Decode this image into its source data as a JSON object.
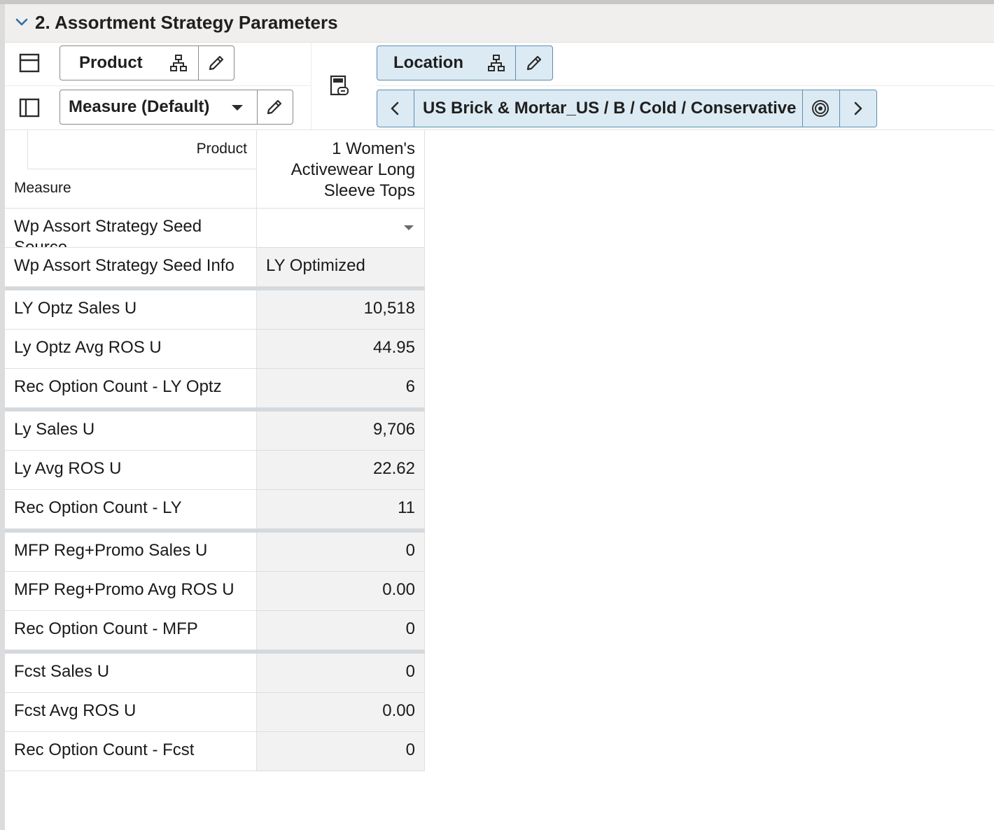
{
  "section": {
    "title": "2. Assortment Strategy Parameters"
  },
  "toolbar": {
    "row_dimension": "Product",
    "column_dimension": "Measure (Default)",
    "page_dimension": "Location",
    "location_path": "US Brick & Mortar_US / B / Cold / Conservative"
  },
  "grid": {
    "corner_top_label": "Product",
    "corner_bottom_label": "Measure",
    "column_header": "1 Women's Activewear Long Sleeve Tops",
    "rows": [
      {
        "label": "Wp Assort Strategy Seed Source",
        "value": ""
      },
      {
        "label": "Wp Assort Strategy Seed Info",
        "value": "LY Optimized"
      },
      {
        "label": "LY Optz Sales U",
        "value": "10,518"
      },
      {
        "label": "Ly Optz Avg ROS U",
        "value": "44.95"
      },
      {
        "label": "Rec Option Count - LY Optz",
        "value": "6"
      },
      {
        "label": "Ly Sales U",
        "value": "9,706"
      },
      {
        "label": "Ly Avg ROS U",
        "value": "22.62"
      },
      {
        "label": "Rec Option Count - LY",
        "value": "11"
      },
      {
        "label": "MFP Reg+Promo Sales U",
        "value": "0"
      },
      {
        "label": "MFP Reg+Promo Avg ROS U",
        "value": "0.00"
      },
      {
        "label": "Rec Option Count - MFP",
        "value": "0"
      },
      {
        "label": "Fcst Sales U",
        "value": "0"
      },
      {
        "label": "Fcst Avg ROS U",
        "value": "0.00"
      },
      {
        "label": "Rec Option Count - Fcst",
        "value": "0"
      }
    ]
  }
}
